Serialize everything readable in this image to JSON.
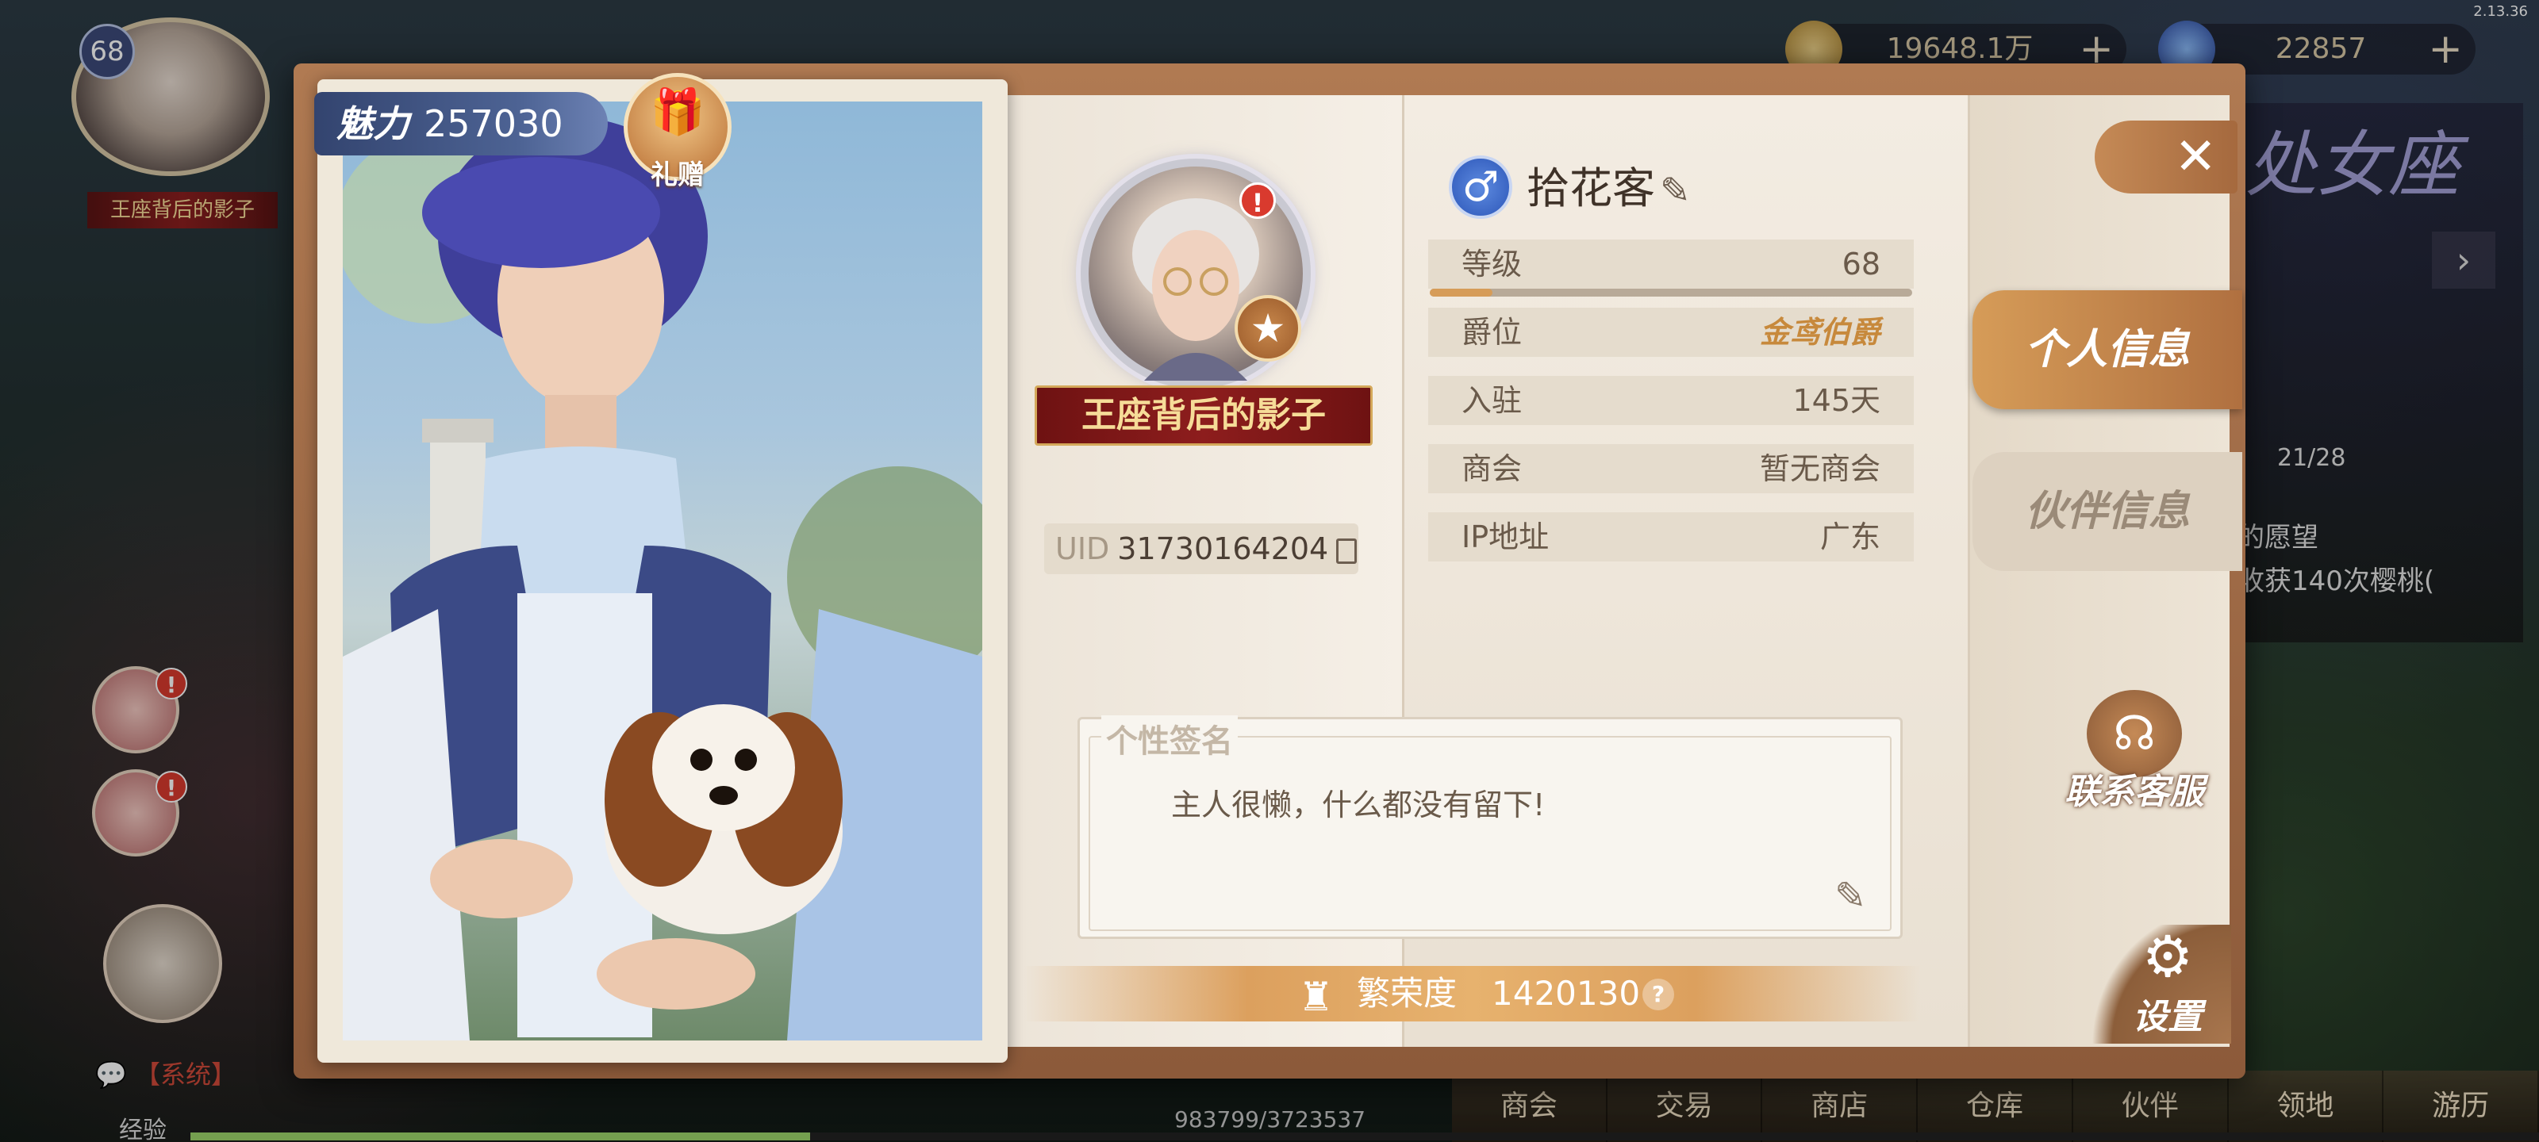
{
  "hud": {
    "version": "2.13.36",
    "player_level": "68",
    "title": "王座背后的影子",
    "gold": "19648.1万",
    "gems": "22857",
    "right_banner": "处女座",
    "right_line_1": "的愿望",
    "right_line_2": "收获140次樱桃(",
    "counter": "21/28",
    "chat_prefix": "【系统】",
    "exp_label": "经验",
    "exp_value": "983799/3723537",
    "exp_fraction": 0.264,
    "nav": [
      "商会",
      "交易",
      "商店",
      "仓库",
      "伙伴",
      "领地",
      "游历"
    ]
  },
  "card": {
    "charm_label": "魅力",
    "charm_value": "257030",
    "gift_label": "礼赠"
  },
  "profile": {
    "name": "拾花客",
    "gender_icon": "male-symbol",
    "title_ribbon": "王座背后的影子",
    "uid_label": "UID",
    "uid_value": "31730164204",
    "rows": [
      {
        "label": "等级",
        "value": "68"
      },
      {
        "label": "爵位",
        "value": "金鸢伯爵"
      },
      {
        "label": "入驻",
        "value": "145天"
      },
      {
        "label": "商会",
        "value": "暂无商会"
      },
      {
        "label": "IP地址",
        "value": "广东"
      }
    ],
    "level_progress": 0.13,
    "signature_title": "个性签名",
    "signature_text": "主人很懒，什么都没有留下!",
    "prosperity_label": "繁荣度",
    "prosperity_value": "1420130",
    "help_glyph": "?"
  },
  "tabs": {
    "personal": "个人信息",
    "partner": "伙伴信息"
  },
  "side": {
    "support": "联系客服",
    "settings": "设置"
  },
  "colors": {
    "accent": "#d69c58",
    "ribbon": "#8d1d1d",
    "gender": "#2c56b8",
    "badge": "#d93a2e"
  }
}
